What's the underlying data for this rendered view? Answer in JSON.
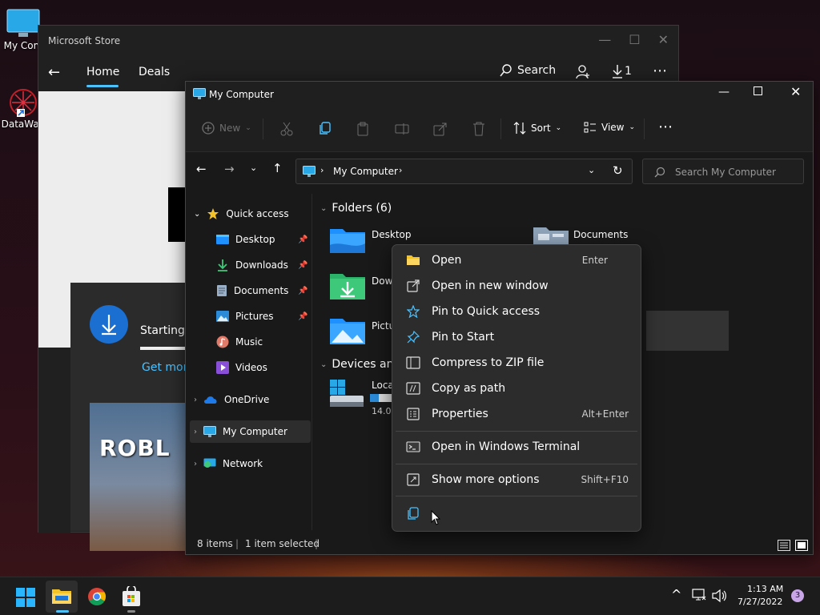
{
  "desktop": {
    "icons": [
      {
        "label": "My Com",
        "icon": "monitor-icon"
      },
      {
        "label": "DataWag",
        "icon": "shortcut-icon"
      }
    ]
  },
  "store": {
    "title": "Microsoft Store",
    "tabs": [
      "Home",
      "Deals"
    ],
    "search_label": "Search",
    "downloads_count": "1",
    "download_status": "Starting",
    "get_more_link": "Get mor",
    "banner_text": "ROBL"
  },
  "explorer": {
    "title": "My Computer",
    "toolbar": {
      "new": "New",
      "sort": "Sort",
      "view": "View"
    },
    "address": {
      "location": "My Computer"
    },
    "search_placeholder": "Search My Computer",
    "nav": {
      "quick_access": "Quick access",
      "items": [
        {
          "label": "Desktop",
          "icon": "desktop-folder-icon",
          "pinned": true
        },
        {
          "label": "Downloads",
          "icon": "download-icon",
          "pinned": true
        },
        {
          "label": "Documents",
          "icon": "document-icon",
          "pinned": true
        },
        {
          "label": "Pictures",
          "icon": "pictures-icon",
          "pinned": true
        },
        {
          "label": "Music",
          "icon": "music-icon",
          "pinned": false
        },
        {
          "label": "Videos",
          "icon": "video-icon",
          "pinned": false
        }
      ],
      "onedrive": "OneDrive",
      "my_computer": "My Computer",
      "network": "Network"
    },
    "content": {
      "folders_header": "Folders (6)",
      "folders": [
        {
          "name": "Desktop",
          "icon": "desktop-folder-icon"
        },
        {
          "name": "Documents",
          "icon": "documents-folder-icon"
        },
        {
          "name": "Down",
          "icon": "downloads-folder-icon"
        },
        {
          "name": "Pictu",
          "icon": "pictures-folder-icon"
        }
      ],
      "devices_header": "Devices and",
      "drive": {
        "name": "Loca",
        "size": "14.0",
        "used_fraction": 0.35
      }
    },
    "status": {
      "items": "8 items",
      "selected": "1 item selected"
    }
  },
  "context_menu": {
    "items": [
      {
        "label": "Open",
        "shortcut": "Enter",
        "icon": "folder-open-icon"
      },
      {
        "label": "Open in new window",
        "shortcut": "",
        "icon": "new-window-icon"
      },
      {
        "label": "Pin to Quick access",
        "shortcut": "",
        "icon": "star-icon"
      },
      {
        "label": "Pin to Start",
        "shortcut": "",
        "icon": "pin-icon"
      },
      {
        "label": "Compress to ZIP file",
        "shortcut": "",
        "icon": "zip-icon"
      },
      {
        "label": "Copy as path",
        "shortcut": "",
        "icon": "copy-path-icon"
      },
      {
        "label": "Properties",
        "shortcut": "Alt+Enter",
        "icon": "properties-icon"
      },
      {
        "label": "Open in Windows Terminal",
        "shortcut": "",
        "icon": "terminal-icon"
      },
      {
        "label": "Show more options",
        "shortcut": "Shift+F10",
        "icon": "more-options-icon"
      }
    ]
  },
  "taskbar": {
    "time": "1:13 AM",
    "date": "7/27/2022",
    "notification_count": "3"
  },
  "colors": {
    "accent": "#4cc2ff",
    "folder_blue": "#1e90ff",
    "star": "#f4c32a"
  }
}
